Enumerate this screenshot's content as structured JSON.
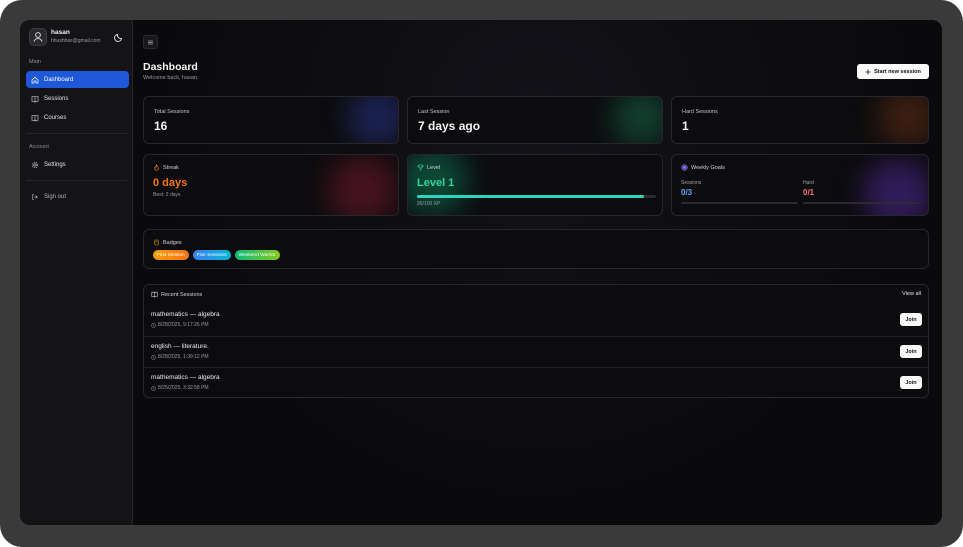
{
  "user": {
    "name": "hasan",
    "email": "hhushhas@gmail.com"
  },
  "sidebar": {
    "main_label": "Main",
    "items": [
      {
        "label": "Dashboard",
        "icon": "home-icon"
      },
      {
        "label": "Sessions",
        "icon": "book-icon"
      },
      {
        "label": "Courses",
        "icon": "book-open-icon"
      }
    ],
    "account_label": "Account",
    "settings_label": "Settings",
    "signout_label": "Sign out"
  },
  "header": {
    "title": "Dashboard",
    "subtitle": "Welcome back, hasan.",
    "new_session_label": "Start new session"
  },
  "stats": {
    "total_sessions": {
      "label": "Total Sessions",
      "value": "16"
    },
    "last_session": {
      "label": "Last Session",
      "value": "7 days ago"
    },
    "hard_sessions": {
      "label": "Hard Sessions",
      "value": "1"
    }
  },
  "streak": {
    "label": "Streak",
    "value": "0 days",
    "best": "Best: 2 days"
  },
  "level": {
    "label": "Level",
    "value": "Level 1",
    "xp": "95/100 XP",
    "progress": 0.95
  },
  "weekly_goals": {
    "label": "Weekly Goals",
    "sessions": {
      "label": "Sessions",
      "value": "0/3",
      "progress": 0
    },
    "hard": {
      "label": "Hard",
      "value": "0/1",
      "progress": 0
    }
  },
  "badges": {
    "label": "Badges",
    "items": [
      "First Session",
      "Five Sessions",
      "Weekend Warrior"
    ]
  },
  "recent": {
    "label": "Recent Sessions",
    "view_all": "View all",
    "join_label": "Join",
    "rows": [
      {
        "title": "mathematics — algebra",
        "time": "8/28/2025, 9:17:26 PM"
      },
      {
        "title": "english — literature.",
        "time": "8/28/2025, 1:39:12 PM"
      },
      {
        "title": "mathematics — algebra",
        "time": "8/25/2025, 3:32:58 PM"
      }
    ]
  }
}
